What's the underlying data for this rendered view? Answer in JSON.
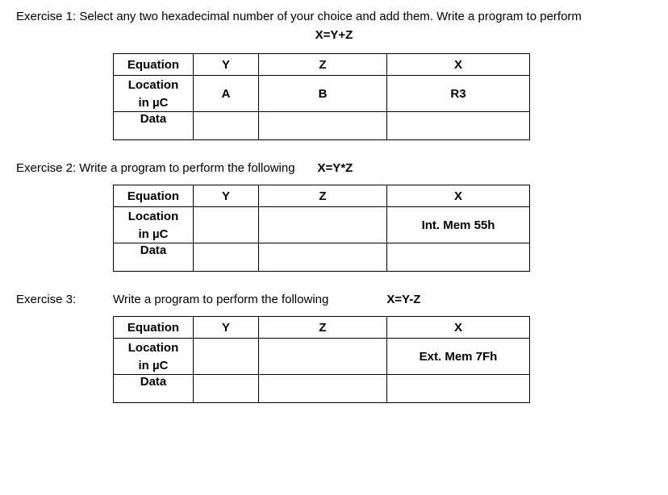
{
  "ex1": {
    "title_prefix": "Exercise 1: ",
    "title_text": "Select any two hexadecimal number of your choice and add them. Write a program to perform",
    "equation": "X=Y+Z",
    "table": {
      "headers": {
        "c1": "Equation",
        "c2": "Y",
        "c3": "Z",
        "c4": "X"
      },
      "location_label_top": "Location",
      "location_label_bottom": "in µC",
      "loc_y": "A",
      "loc_z": "B",
      "loc_x": "R3",
      "data_label": "Data",
      "data_y": "",
      "data_z": "",
      "data_x": ""
    }
  },
  "ex2": {
    "title_prefix": "Exercise 2: ",
    "title_text": "Write a program to perform the following",
    "equation": "X=Y*Z",
    "table": {
      "headers": {
        "c1": "Equation",
        "c2": "Y",
        "c3": "Z",
        "c4": "X"
      },
      "location_label_top": "Location",
      "location_label_bottom": "in µC",
      "loc_y": "",
      "loc_z": "",
      "loc_x": "Int. Mem 55h",
      "data_label": "Data",
      "data_y": "",
      "data_z": "",
      "data_x": ""
    }
  },
  "ex3": {
    "title_prefix": "Exercise 3:",
    "title_text": "Write a program to perform the following",
    "equation": "X=Y-Z",
    "table": {
      "headers": {
        "c1": "Equation",
        "c2": "Y",
        "c3": "Z",
        "c4": "X"
      },
      "location_label_top": "Location",
      "location_label_bottom": "in µC",
      "loc_y": "",
      "loc_z": "",
      "loc_x": "Ext. Mem 7Fh",
      "data_label": "Data",
      "data_y": "",
      "data_z": "",
      "data_x": ""
    }
  }
}
